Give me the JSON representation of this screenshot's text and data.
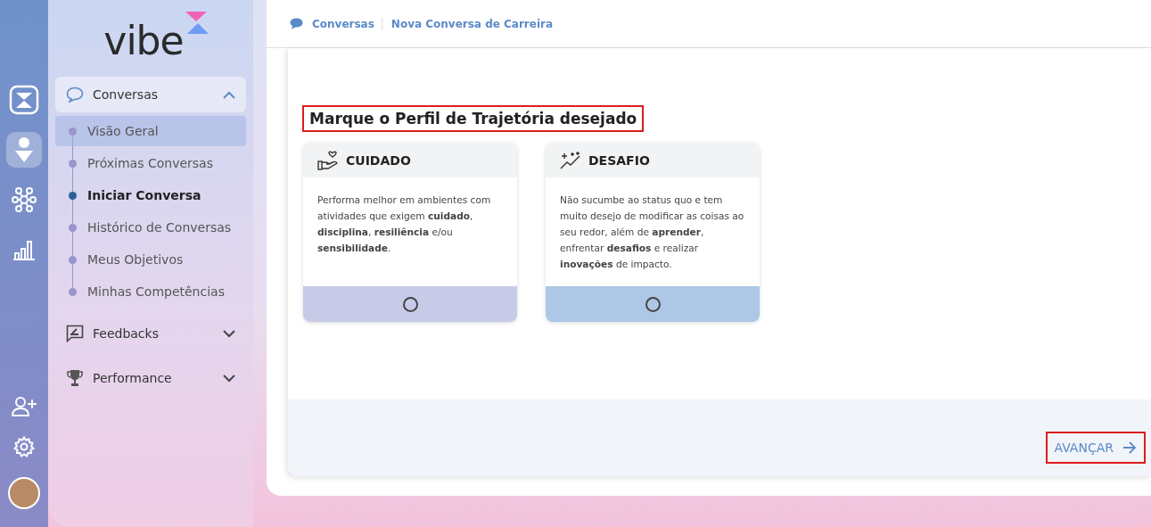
{
  "rail": {
    "items": [
      {
        "kind": "logo",
        "selected": false
      },
      {
        "kind": "ai",
        "selected": true
      },
      {
        "kind": "network",
        "selected": false
      },
      {
        "kind": "chart",
        "selected": false
      }
    ],
    "bottom": [
      {
        "kind": "add-user"
      },
      {
        "kind": "settings"
      },
      {
        "kind": "avatar"
      }
    ]
  },
  "sidebar": {
    "logo": "vibe",
    "groups": [
      {
        "label": "Conversas",
        "kind": "chat",
        "expanded": true,
        "children": [
          {
            "label": "Visão Geral",
            "selected": true,
            "current": false
          },
          {
            "label": "Próximas Conversas",
            "selected": false,
            "current": false
          },
          {
            "label": "Iniciar Conversa",
            "selected": false,
            "current": true
          },
          {
            "label": "Histórico de Conversas",
            "selected": false,
            "current": false
          },
          {
            "label": "Meus Objetivos",
            "selected": false,
            "current": false
          },
          {
            "label": "Minhas Competências",
            "selected": false,
            "current": false
          }
        ]
      },
      {
        "label": "Feedbacks",
        "kind": "feedback",
        "expanded": false
      },
      {
        "label": "Performance",
        "kind": "trophy",
        "expanded": false
      }
    ]
  },
  "breadcrumb": [
    "Conversas",
    "Nova Conversa de Carreira"
  ],
  "section": {
    "title": "Marque o Perfil de Trajetória desejado",
    "highlighted": true
  },
  "options": [
    {
      "kind": "care",
      "title": "CUIDADO",
      "description": "Performa melhor em ambientes com atividades que exigem **cuidado**, **disciplina**, **resiliência** e/ou **sensibilidade**.",
      "color": "#c8cbe8",
      "selected": false
    },
    {
      "kind": "challenge",
      "title": "DESAFIO",
      "description": "Não sucumbe ao status quo e tem muito desejo de modificar as coisas ao seu redor, além de **aprender**, enfrentar **desafios** e realizar **inovações** de impacto.",
      "color": "#adc7e6",
      "selected": false
    }
  ],
  "next_button": {
    "label": "AVANÇAR",
    "highlighted": true
  }
}
